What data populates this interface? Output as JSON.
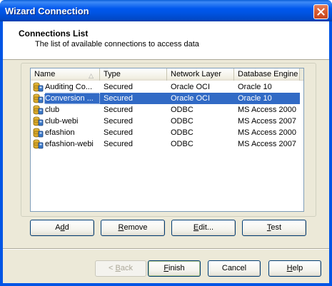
{
  "window": {
    "title": "Wizard Connection"
  },
  "header": {
    "title": "Connections List",
    "subtitle": "The list of available connections to access data"
  },
  "table": {
    "columns": [
      "Name",
      "Type",
      "Network Layer",
      "Database Engine"
    ],
    "sorted_column": "Name",
    "rows": [
      {
        "name": "Auditing Co...",
        "type": "Secured",
        "network": "Oracle OCI",
        "engine": "Oracle 10",
        "selected": false
      },
      {
        "name": "Conversion ...",
        "type": "Secured",
        "network": "Oracle OCI",
        "engine": "Oracle 10",
        "selected": true
      },
      {
        "name": "club",
        "type": "Secured",
        "network": "ODBC",
        "engine": "MS Access 2000",
        "selected": false
      },
      {
        "name": "club-webi",
        "type": "Secured",
        "network": "ODBC",
        "engine": "MS Access 2007",
        "selected": false
      },
      {
        "name": "efashion",
        "type": "Secured",
        "network": "ODBC",
        "engine": "MS Access 2000",
        "selected": false
      },
      {
        "name": "efashion-webi",
        "type": "Secured",
        "network": "ODBC",
        "engine": "MS Access 2007",
        "selected": false
      }
    ]
  },
  "actions": {
    "add": {
      "pre": "A",
      "ul": "d",
      "post": "d"
    },
    "remove": {
      "pre": "",
      "ul": "R",
      "post": "emove"
    },
    "edit": {
      "pre": "",
      "ul": "E",
      "post": "dit..."
    },
    "test": {
      "pre": "",
      "ul": "T",
      "post": "est"
    }
  },
  "footer": {
    "back": {
      "pre": "< ",
      "ul": "B",
      "post": "ack"
    },
    "finish": {
      "pre": "",
      "ul": "F",
      "post": "inish"
    },
    "cancel": "Cancel",
    "help": {
      "pre": "",
      "ul": "H",
      "post": "elp"
    }
  },
  "colors": {
    "selection": "#316ac5",
    "titlebar": "#0054e3",
    "dialog": "#ece9d8"
  }
}
